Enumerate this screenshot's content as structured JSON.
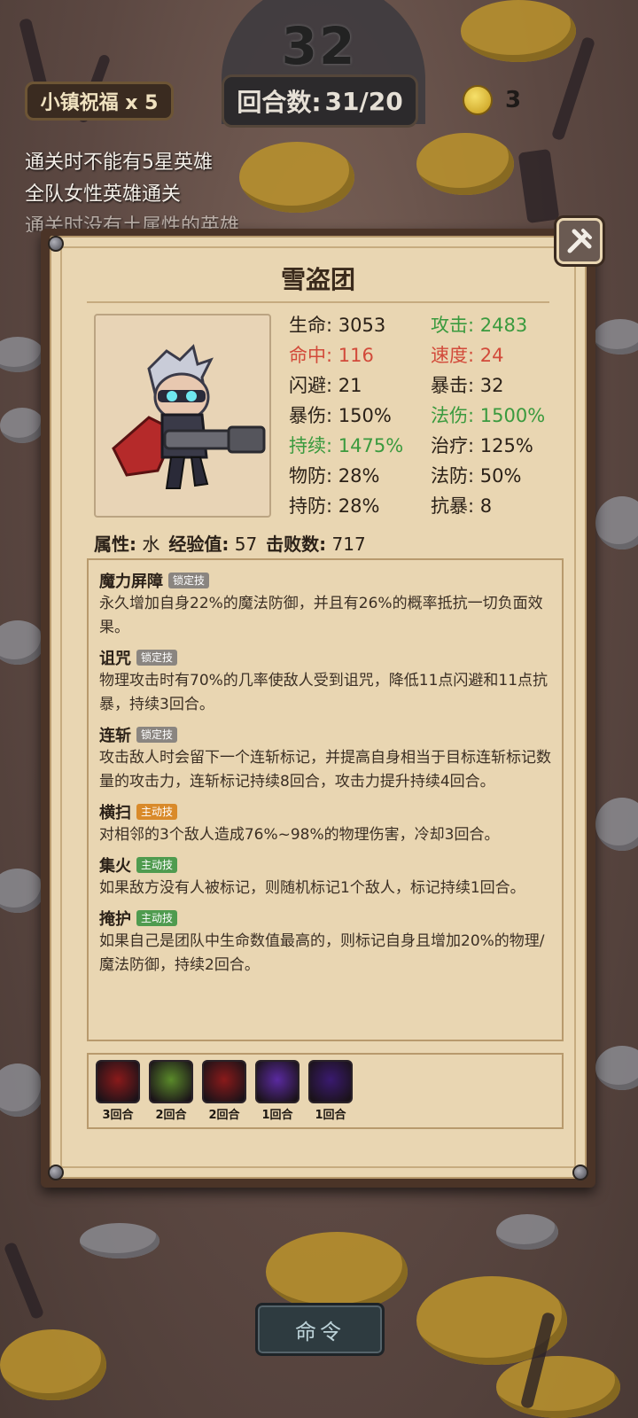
{
  "hud": {
    "counter": "32",
    "blessing": "小镇祝福 x 5",
    "round_label": "回合数:",
    "round_value": "31/20",
    "coins": "3"
  },
  "objectives": [
    "通关时不能有5星英雄",
    "全队女性英雄通关",
    "通关时没有土属性的英雄"
  ],
  "panel": {
    "title": "雪盗团",
    "stats": [
      {
        "label": "生命",
        "value": "3053",
        "color": "normal"
      },
      {
        "label": "攻击",
        "value": "2483",
        "color": "green"
      },
      {
        "label": "命中",
        "value": "116",
        "color": "red"
      },
      {
        "label": "速度",
        "value": "24",
        "color": "red"
      },
      {
        "label": "闪避",
        "value": "21",
        "color": "normal"
      },
      {
        "label": "暴击",
        "value": "32",
        "color": "normal"
      },
      {
        "label": "暴伤",
        "value": "150%",
        "color": "normal"
      },
      {
        "label": "法伤",
        "value": "1500%",
        "color": "green"
      },
      {
        "label": "持续",
        "value": "1475%",
        "color": "green"
      },
      {
        "label": "治疗",
        "value": "125%",
        "color": "normal"
      },
      {
        "label": "物防",
        "value": "28%",
        "color": "normal"
      },
      {
        "label": "法防",
        "value": "50%",
        "color": "normal"
      },
      {
        "label": "持防",
        "value": "28%",
        "color": "normal"
      },
      {
        "label": "抗暴",
        "value": "8",
        "color": "normal"
      }
    ],
    "meta": {
      "element_label": "属性:",
      "element_value": "水",
      "exp_label": "经验值:",
      "exp_value": "57",
      "kills_label": "击败数:",
      "kills_value": "717"
    },
    "skills": [
      {
        "name": "魔力屏障",
        "tag": "锁定技",
        "tag_type": "lock",
        "desc": "永久增加自身22%的魔法防御，并且有26%的概率抵抗一切负面效果。"
      },
      {
        "name": "诅咒",
        "tag": "锁定技",
        "tag_type": "lock",
        "desc": "物理攻击时有70%的几率使敌人受到诅咒，降低11点闪避和11点抗暴，持续3回合。"
      },
      {
        "name": "连斩",
        "tag": "锁定技",
        "tag_type": "lock",
        "desc": "攻击敌人时会留下一个连斩标记，并提高自身相当于目标连斩标记数量的攻击力，连斩标记持续8回合，攻击力提升持续4回合。"
      },
      {
        "name": "横扫",
        "tag": "主动技",
        "tag_type": "active-orange",
        "desc": "对相邻的3个敌人造成76%~98%的物理伤害，冷却3回合。"
      },
      {
        "name": "集火",
        "tag": "主动技",
        "tag_type": "active-green",
        "desc": "如果敌方没有人被标记，则随机标记1个敌人，标记持续1回合。"
      },
      {
        "name": "掩护",
        "tag": "主动技",
        "tag_type": "active-green",
        "desc": "如果自己是团队中生命数值最高的，则标记自身且增加20%的物理/魔法防御，持续2回合。"
      }
    ],
    "buffs": [
      {
        "icon": "red-claw-icon",
        "label": "3回合",
        "color": "#8a1a1a"
      },
      {
        "icon": "green-potion-icon",
        "label": "2回合",
        "color": "#5a8a2a"
      },
      {
        "icon": "red-claw-icon",
        "label": "2回合",
        "color": "#8a1a1a"
      },
      {
        "icon": "purple-burst-icon",
        "label": "1回合",
        "color": "#5a2aa0"
      },
      {
        "icon": "purple-shadow-icon",
        "label": "1回合",
        "color": "#3a1a70"
      }
    ]
  },
  "command_button": "命令"
}
